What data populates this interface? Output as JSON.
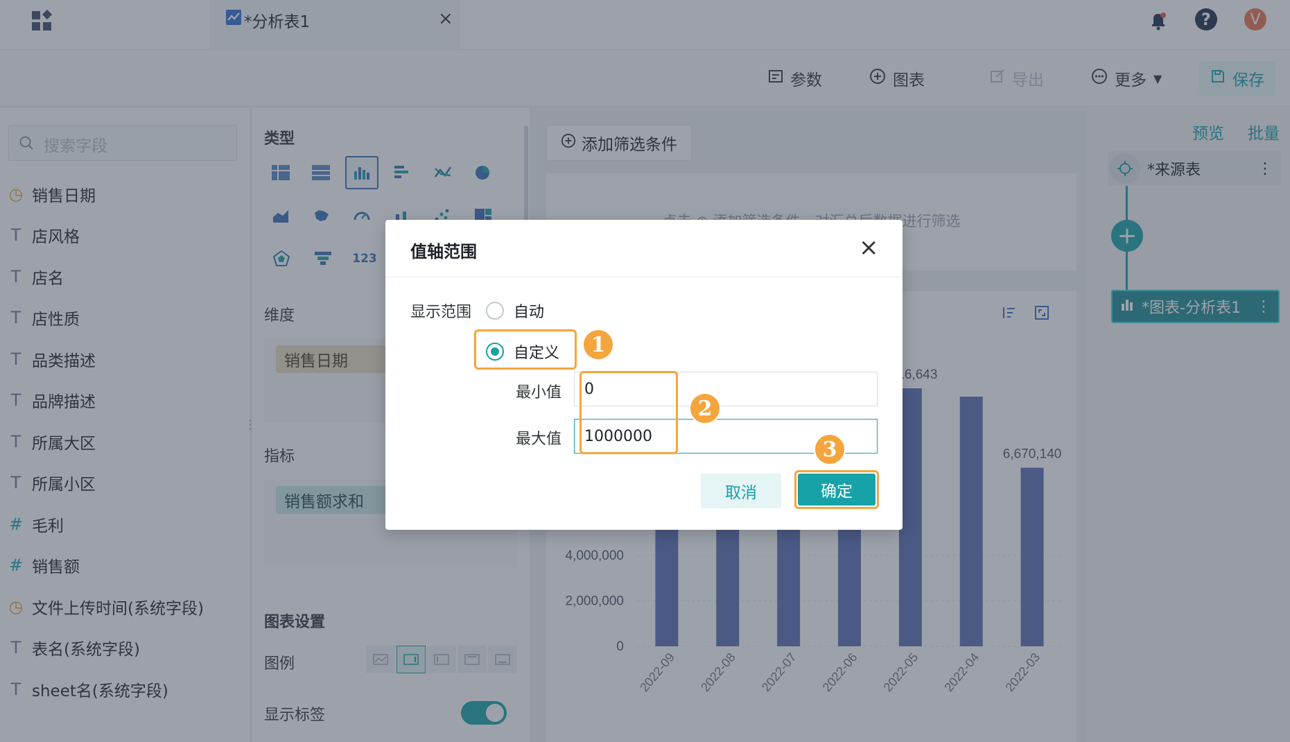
{
  "tab": {
    "title": "*分析表1"
  },
  "toolbar": {
    "params": "参数",
    "chart": "图表",
    "export": "导出",
    "more": "更多",
    "save": "保存"
  },
  "left": {
    "search_placeholder": "搜索字段",
    "fields": [
      {
        "icon": "date-field-icon",
        "label": "销售日期"
      },
      {
        "icon": "text-field-icon",
        "label": "店风格"
      },
      {
        "icon": "text-field-icon",
        "label": "店名"
      },
      {
        "icon": "text-field-icon",
        "label": "店性质"
      },
      {
        "icon": "text-field-icon",
        "label": "品类描述"
      },
      {
        "icon": "text-field-icon",
        "label": "品牌描述"
      },
      {
        "icon": "text-field-icon",
        "label": "所属大区"
      },
      {
        "icon": "text-field-icon",
        "label": "所属小区"
      },
      {
        "icon": "number-field-icon",
        "label": "毛利"
      },
      {
        "icon": "number-field-icon",
        "label": "销售额"
      },
      {
        "icon": "time-field-icon",
        "label": "文件上传时间(系统字段)"
      },
      {
        "icon": "text-field-icon",
        "label": "表名(系统字段)"
      },
      {
        "icon": "text-field-icon",
        "label": "sheet名(系统字段)"
      }
    ]
  },
  "config": {
    "type_title": "类型",
    "dimension_title": "维度",
    "dimension_pill": "销售日期",
    "measure_title": "指标",
    "measure_pill": "销售额求和",
    "chart_settings_title": "图表设置",
    "legend_label": "图例",
    "show_label": "显示标签"
  },
  "filter": {
    "add_button": "添加筛选条件",
    "hint": "点击 ⊕ 添加筛选条件，对汇总后数据进行筛选"
  },
  "flow": {
    "preview": "预览",
    "batch": "批量",
    "source_node": "*来源表",
    "chart_node": "*图表-分析表1"
  },
  "chart_data": {
    "type": "bar",
    "categories": [
      "2022-09",
      "2022-08",
      "2022-07",
      "2022-06",
      "2022-05",
      "2022-04",
      "2022-03"
    ],
    "values": [
      null,
      null,
      null,
      null,
      null,
      null,
      6670140
    ],
    "data_labels": [
      "",
      "",
      "",
      "",
      "16,643",
      "",
      "6,670,140"
    ],
    "y_ticks": [
      "0",
      "2,000,000",
      "4,000,000"
    ],
    "color": "#5b6fb5"
  },
  "dialog": {
    "title": "值轴范围",
    "range_label": "显示范围",
    "auto_label": "自动",
    "custom_label": "自定义",
    "min_label": "最小值",
    "min_value": "0",
    "max_label": "最大值",
    "max_value": "1000000",
    "cancel": "取消",
    "confirm": "确定",
    "steps": [
      "1",
      "2",
      "3"
    ]
  },
  "avatar": "V",
  "colors": {
    "accent": "#17a2a8",
    "callout": "#f5a53d",
    "bar": "#5b6fb5"
  }
}
